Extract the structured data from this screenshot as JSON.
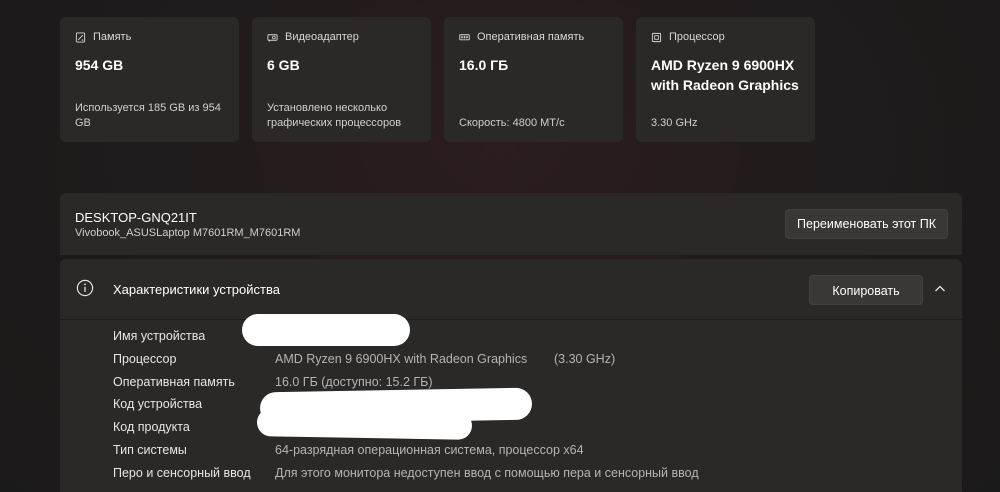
{
  "cards": [
    {
      "icon": "storage-icon",
      "label": "Память",
      "value": "954 GB",
      "detail": "Используется 185 GB из 954 GB"
    },
    {
      "icon": "gpu-icon",
      "label": "Видеоадаптер",
      "value": "6 GB",
      "detail": "Установлено несколько графических процессоров"
    },
    {
      "icon": "ram-icon",
      "label": "Оперативная память",
      "value": "16.0 ГБ",
      "detail": "Скорость: 4800 МТ/с"
    },
    {
      "icon": "cpu-icon",
      "label": "Процессор",
      "value": "AMD Ryzen 9 6900HX with Radeon Graphics",
      "detail": "3.30 GHz"
    }
  ],
  "device": {
    "name": "DESKTOP-GNQ21IT",
    "model": "Vivobook_ASUSLaptop M7601RM_M7601RM",
    "rename_label": "Переименовать этот ПК"
  },
  "specs": {
    "title": "Характеристики устройства",
    "copy_label": "Копировать",
    "rows": [
      {
        "label": "Имя устройства",
        "value": "",
        "extra": ""
      },
      {
        "label": "Процессор",
        "value": "AMD Ryzen 9 6900HX with Radeon Graphics",
        "extra": "(3.30 GHz)"
      },
      {
        "label": "Оперативная память",
        "value": "16.0 ГБ (доступно: 15.2 ГБ)",
        "extra": ""
      },
      {
        "label": "Код устройства",
        "value": "",
        "extra": ""
      },
      {
        "label": "Код продукта",
        "value": "",
        "extra": ""
      },
      {
        "label": "Тип системы",
        "value": "64-разрядная операционная система, процессор x64",
        "extra": ""
      },
      {
        "label": "Перо и сенсорный ввод",
        "value": "Для этого монитора недоступен ввод с помощью пера и сенсорный ввод",
        "extra": ""
      }
    ]
  },
  "colors": {
    "background": "#1c1a1b",
    "card": "#2b2828",
    "button": "#3a3737",
    "text": "#ffffff",
    "muted_text": "#b4b4b4"
  }
}
